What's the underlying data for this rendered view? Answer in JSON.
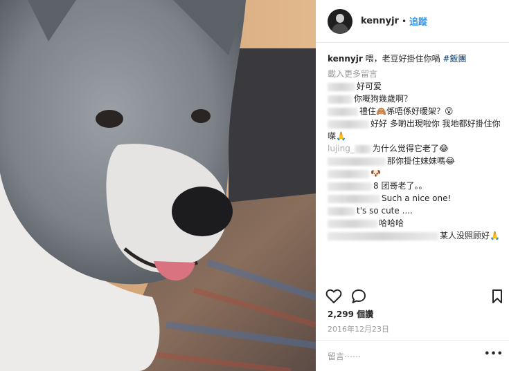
{
  "post": {
    "username": "kennyjr",
    "separator": "•",
    "follow_label": "追蹤",
    "caption_user": "kennyjr",
    "caption_text": "喂，老豆好掛住你喎 ",
    "caption_hashtag": "#飯團",
    "load_more": "載入更多留言",
    "comments": [
      {
        "text": "好可爱"
      },
      {
        "text": "你嘅狗幾歲啊？"
      },
      {
        "text": "禮住🙈係唔係好暖架？😮"
      },
      {
        "text": "好好 多啲出現啦你 我地都好掛住你㗎🙏"
      },
      {
        "user": "lujing_",
        "text": "为什么觉得它老了😂"
      },
      {
        "text": "那你掛住妹妹嗎😂"
      },
      {
        "text": "🐶"
      },
      {
        "text": "8 团哥老了。。"
      },
      {
        "text": "Such a nice one!"
      },
      {
        "text": "t's so cute ...."
      },
      {
        "text": "哈哈哈"
      },
      {
        "text": "某人没照顾好🙏"
      }
    ],
    "likes": "2,299 個讚",
    "date": "2016年12月23日",
    "add_comment_placeholder": "留言⋯⋯",
    "more_label": "•••"
  },
  "icons": {
    "like": "heart-icon",
    "comment": "speech-bubble-icon",
    "save": "bookmark-icon",
    "options": "more-options-icon"
  }
}
